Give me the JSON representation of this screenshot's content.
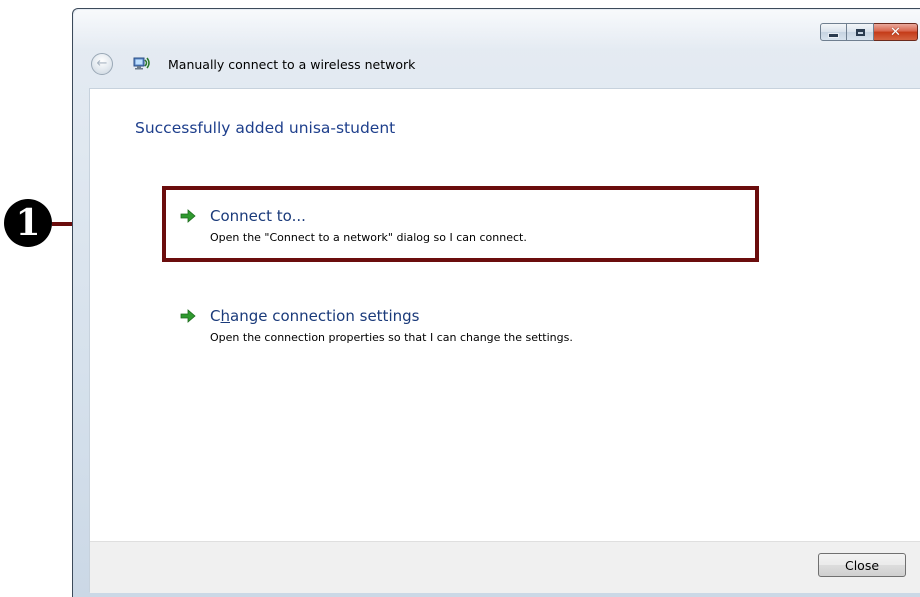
{
  "window": {
    "title": "Manually connect to a wireless network",
    "caption_buttons": {
      "minimize": "minimize-icon",
      "maximize": "maximize-icon",
      "close": "close-icon"
    }
  },
  "main": {
    "heading": "Successfully added unisa-student",
    "commands": [
      {
        "label": "Connect to...",
        "description": "Open the \"Connect to a network\" dialog so I can connect.",
        "icon": "green-arrow-icon"
      },
      {
        "label_parts": [
          "C",
          "h",
          "ange connection settings"
        ],
        "description": "Open the connection properties so that I can change the settings.",
        "icon": "green-arrow-icon"
      }
    ]
  },
  "footer": {
    "close_label": "Close"
  },
  "annotation": {
    "number": "1",
    "color": "#6b0d0d"
  }
}
